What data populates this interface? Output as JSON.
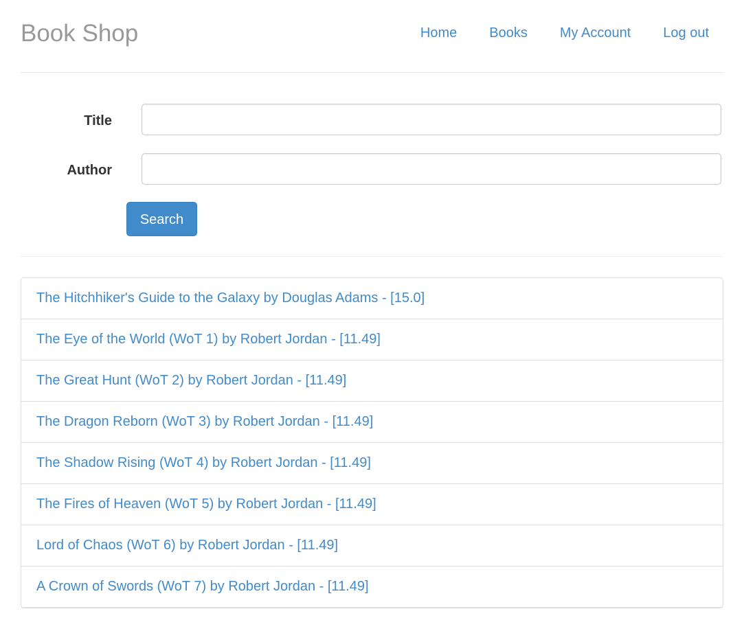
{
  "header": {
    "brand": "Book Shop",
    "nav": [
      {
        "label": "Home"
      },
      {
        "label": "Books"
      },
      {
        "label": "My Account"
      },
      {
        "label": "Log out"
      }
    ]
  },
  "search_form": {
    "title_label": "Title",
    "title_value": "",
    "author_label": "Author",
    "author_value": "",
    "search_button": "Search"
  },
  "books": [
    {
      "text": "The Hitchhiker's Guide to the Galaxy by Douglas Adams - [15.0]"
    },
    {
      "text": "The Eye of the World (WoT 1) by Robert Jordan - [11.49]"
    },
    {
      "text": "The Great Hunt (WoT 2) by Robert Jordan - [11.49]"
    },
    {
      "text": "The Dragon Reborn (WoT 3) by Robert Jordan - [11.49]"
    },
    {
      "text": "The Shadow Rising (WoT 4) by Robert Jordan - [11.49]"
    },
    {
      "text": "The Fires of Heaven (WoT 5) by Robert Jordan - [11.49]"
    },
    {
      "text": "Lord of Chaos (WoT 6) by Robert Jordan - [11.49]"
    },
    {
      "text": "A Crown of Swords (WoT 7) by Robert Jordan - [11.49]"
    }
  ],
  "colors": {
    "link": "#428bca",
    "brand": "#999999",
    "primary_button": "#428bca",
    "border": "#dddddd"
  }
}
